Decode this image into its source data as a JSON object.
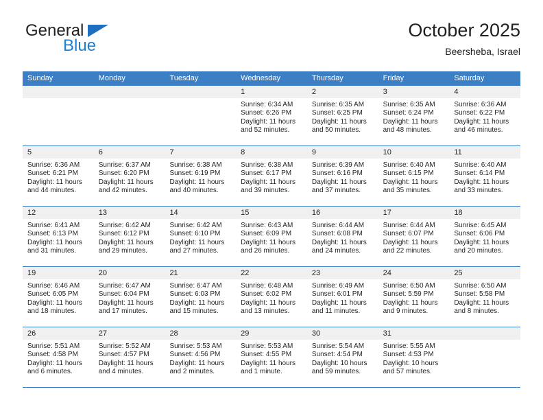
{
  "brand": {
    "name_top": "General",
    "name_bottom": "Blue",
    "accent_color": "#1f7fd0",
    "triangle_color": "#1f6fc0"
  },
  "header": {
    "title": "October 2025",
    "subtitle": "Beersheba, Israel"
  },
  "calendar": {
    "header_bg": "#3c7fc4",
    "day_band_bg": "#f0f0f0",
    "weekdays": [
      "Sunday",
      "Monday",
      "Tuesday",
      "Wednesday",
      "Thursday",
      "Friday",
      "Saturday"
    ],
    "labels": {
      "sunrise": "Sunrise:",
      "sunset": "Sunset:",
      "daylight": "Daylight:"
    },
    "weeks": [
      [
        {
          "day": "",
          "empty": true
        },
        {
          "day": "",
          "empty": true
        },
        {
          "day": "",
          "empty": true
        },
        {
          "day": "1",
          "sunrise": "Sunrise: 6:34 AM",
          "sunset": "Sunset: 6:26 PM",
          "daylight_1": "Daylight: 11 hours",
          "daylight_2": "and 52 minutes."
        },
        {
          "day": "2",
          "sunrise": "Sunrise: 6:35 AM",
          "sunset": "Sunset: 6:25 PM",
          "daylight_1": "Daylight: 11 hours",
          "daylight_2": "and 50 minutes."
        },
        {
          "day": "3",
          "sunrise": "Sunrise: 6:35 AM",
          "sunset": "Sunset: 6:24 PM",
          "daylight_1": "Daylight: 11 hours",
          "daylight_2": "and 48 minutes."
        },
        {
          "day": "4",
          "sunrise": "Sunrise: 6:36 AM",
          "sunset": "Sunset: 6:22 PM",
          "daylight_1": "Daylight: 11 hours",
          "daylight_2": "and 46 minutes."
        }
      ],
      [
        {
          "day": "5",
          "sunrise": "Sunrise: 6:36 AM",
          "sunset": "Sunset: 6:21 PM",
          "daylight_1": "Daylight: 11 hours",
          "daylight_2": "and 44 minutes."
        },
        {
          "day": "6",
          "sunrise": "Sunrise: 6:37 AM",
          "sunset": "Sunset: 6:20 PM",
          "daylight_1": "Daylight: 11 hours",
          "daylight_2": "and 42 minutes."
        },
        {
          "day": "7",
          "sunrise": "Sunrise: 6:38 AM",
          "sunset": "Sunset: 6:19 PM",
          "daylight_1": "Daylight: 11 hours",
          "daylight_2": "and 40 minutes."
        },
        {
          "day": "8",
          "sunrise": "Sunrise: 6:38 AM",
          "sunset": "Sunset: 6:17 PM",
          "daylight_1": "Daylight: 11 hours",
          "daylight_2": "and 39 minutes."
        },
        {
          "day": "9",
          "sunrise": "Sunrise: 6:39 AM",
          "sunset": "Sunset: 6:16 PM",
          "daylight_1": "Daylight: 11 hours",
          "daylight_2": "and 37 minutes."
        },
        {
          "day": "10",
          "sunrise": "Sunrise: 6:40 AM",
          "sunset": "Sunset: 6:15 PM",
          "daylight_1": "Daylight: 11 hours",
          "daylight_2": "and 35 minutes."
        },
        {
          "day": "11",
          "sunrise": "Sunrise: 6:40 AM",
          "sunset": "Sunset: 6:14 PM",
          "daylight_1": "Daylight: 11 hours",
          "daylight_2": "and 33 minutes."
        }
      ],
      [
        {
          "day": "12",
          "sunrise": "Sunrise: 6:41 AM",
          "sunset": "Sunset: 6:13 PM",
          "daylight_1": "Daylight: 11 hours",
          "daylight_2": "and 31 minutes."
        },
        {
          "day": "13",
          "sunrise": "Sunrise: 6:42 AM",
          "sunset": "Sunset: 6:12 PM",
          "daylight_1": "Daylight: 11 hours",
          "daylight_2": "and 29 minutes."
        },
        {
          "day": "14",
          "sunrise": "Sunrise: 6:42 AM",
          "sunset": "Sunset: 6:10 PM",
          "daylight_1": "Daylight: 11 hours",
          "daylight_2": "and 27 minutes."
        },
        {
          "day": "15",
          "sunrise": "Sunrise: 6:43 AM",
          "sunset": "Sunset: 6:09 PM",
          "daylight_1": "Daylight: 11 hours",
          "daylight_2": "and 26 minutes."
        },
        {
          "day": "16",
          "sunrise": "Sunrise: 6:44 AM",
          "sunset": "Sunset: 6:08 PM",
          "daylight_1": "Daylight: 11 hours",
          "daylight_2": "and 24 minutes."
        },
        {
          "day": "17",
          "sunrise": "Sunrise: 6:44 AM",
          "sunset": "Sunset: 6:07 PM",
          "daylight_1": "Daylight: 11 hours",
          "daylight_2": "and 22 minutes."
        },
        {
          "day": "18",
          "sunrise": "Sunrise: 6:45 AM",
          "sunset": "Sunset: 6:06 PM",
          "daylight_1": "Daylight: 11 hours",
          "daylight_2": "and 20 minutes."
        }
      ],
      [
        {
          "day": "19",
          "sunrise": "Sunrise: 6:46 AM",
          "sunset": "Sunset: 6:05 PM",
          "daylight_1": "Daylight: 11 hours",
          "daylight_2": "and 18 minutes."
        },
        {
          "day": "20",
          "sunrise": "Sunrise: 6:47 AM",
          "sunset": "Sunset: 6:04 PM",
          "daylight_1": "Daylight: 11 hours",
          "daylight_2": "and 17 minutes."
        },
        {
          "day": "21",
          "sunrise": "Sunrise: 6:47 AM",
          "sunset": "Sunset: 6:03 PM",
          "daylight_1": "Daylight: 11 hours",
          "daylight_2": "and 15 minutes."
        },
        {
          "day": "22",
          "sunrise": "Sunrise: 6:48 AM",
          "sunset": "Sunset: 6:02 PM",
          "daylight_1": "Daylight: 11 hours",
          "daylight_2": "and 13 minutes."
        },
        {
          "day": "23",
          "sunrise": "Sunrise: 6:49 AM",
          "sunset": "Sunset: 6:01 PM",
          "daylight_1": "Daylight: 11 hours",
          "daylight_2": "and 11 minutes."
        },
        {
          "day": "24",
          "sunrise": "Sunrise: 6:50 AM",
          "sunset": "Sunset: 5:59 PM",
          "daylight_1": "Daylight: 11 hours",
          "daylight_2": "and 9 minutes."
        },
        {
          "day": "25",
          "sunrise": "Sunrise: 6:50 AM",
          "sunset": "Sunset: 5:58 PM",
          "daylight_1": "Daylight: 11 hours",
          "daylight_2": "and 8 minutes."
        }
      ],
      [
        {
          "day": "26",
          "sunrise": "Sunrise: 5:51 AM",
          "sunset": "Sunset: 4:58 PM",
          "daylight_1": "Daylight: 11 hours",
          "daylight_2": "and 6 minutes."
        },
        {
          "day": "27",
          "sunrise": "Sunrise: 5:52 AM",
          "sunset": "Sunset: 4:57 PM",
          "daylight_1": "Daylight: 11 hours",
          "daylight_2": "and 4 minutes."
        },
        {
          "day": "28",
          "sunrise": "Sunrise: 5:53 AM",
          "sunset": "Sunset: 4:56 PM",
          "daylight_1": "Daylight: 11 hours",
          "daylight_2": "and 2 minutes."
        },
        {
          "day": "29",
          "sunrise": "Sunrise: 5:53 AM",
          "sunset": "Sunset: 4:55 PM",
          "daylight_1": "Daylight: 11 hours",
          "daylight_2": "and 1 minute."
        },
        {
          "day": "30",
          "sunrise": "Sunrise: 5:54 AM",
          "sunset": "Sunset: 4:54 PM",
          "daylight_1": "Daylight: 10 hours",
          "daylight_2": "and 59 minutes."
        },
        {
          "day": "31",
          "sunrise": "Sunrise: 5:55 AM",
          "sunset": "Sunset: 4:53 PM",
          "daylight_1": "Daylight: 10 hours",
          "daylight_2": "and 57 minutes."
        },
        {
          "day": "",
          "empty": true
        }
      ]
    ]
  }
}
